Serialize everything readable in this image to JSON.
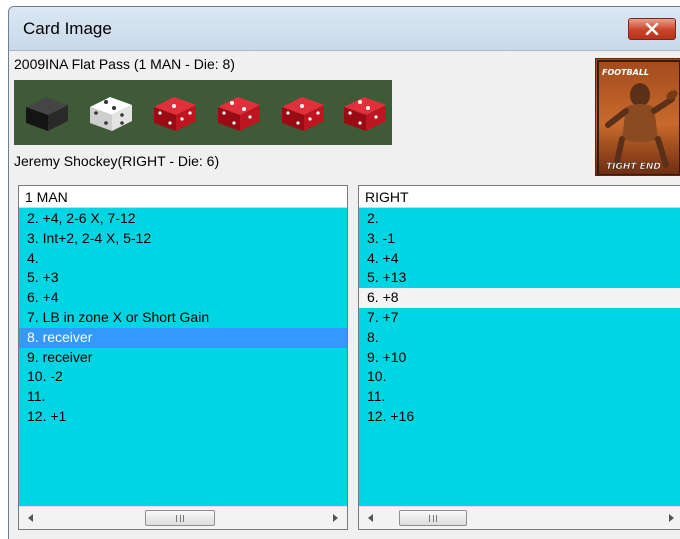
{
  "window": {
    "title": "Card Image"
  },
  "play": {
    "label": "2009INA Flat Pass (1 MAN - Die: 8)"
  },
  "player": {
    "label": "Jeremy Shockey(RIGHT - Die: 6)"
  },
  "dice": [
    {
      "color": "black",
      "fill": "#1e1e1e"
    },
    {
      "color": "white",
      "fill": "#e6e6e6"
    },
    {
      "color": "red",
      "fill": "#c8141e"
    },
    {
      "color": "red",
      "fill": "#c8141e"
    },
    {
      "color": "red",
      "fill": "#c8141e"
    },
    {
      "color": "red",
      "fill": "#c8141e"
    }
  ],
  "card": {
    "top_text": "FOOTBALL",
    "bottom_text": "TIGHT END"
  },
  "left_panel": {
    "header": "1 MAN",
    "selected_index": 6,
    "rows": [
      "2. +4, 2-6 X, 7-12",
      "3. Int+2, 2-4 X, 5-12",
      "4.",
      "5. +3",
      "6. +4",
      "7. LB in zone X or Short Gain",
      "8. receiver",
      "9. receiver",
      "10. -2",
      "11.",
      "12. +1"
    ]
  },
  "right_panel": {
    "header": "RIGHT",
    "highlight_index": 4,
    "rows": [
      "2.",
      "3. -1",
      "4. +4",
      "5. +13",
      "6. +8",
      "7. +7",
      "8.",
      "9. +10",
      "10.",
      "11.",
      "12. +16"
    ]
  },
  "scrollbar": {
    "left_arrow": "◄",
    "right_arrow": "►",
    "grip": "III"
  },
  "colors": {
    "panel_bg": "#00d6e3",
    "selection": "#3399ff",
    "close_red": "#c9442a",
    "dice_bg": "#3f5a36"
  }
}
